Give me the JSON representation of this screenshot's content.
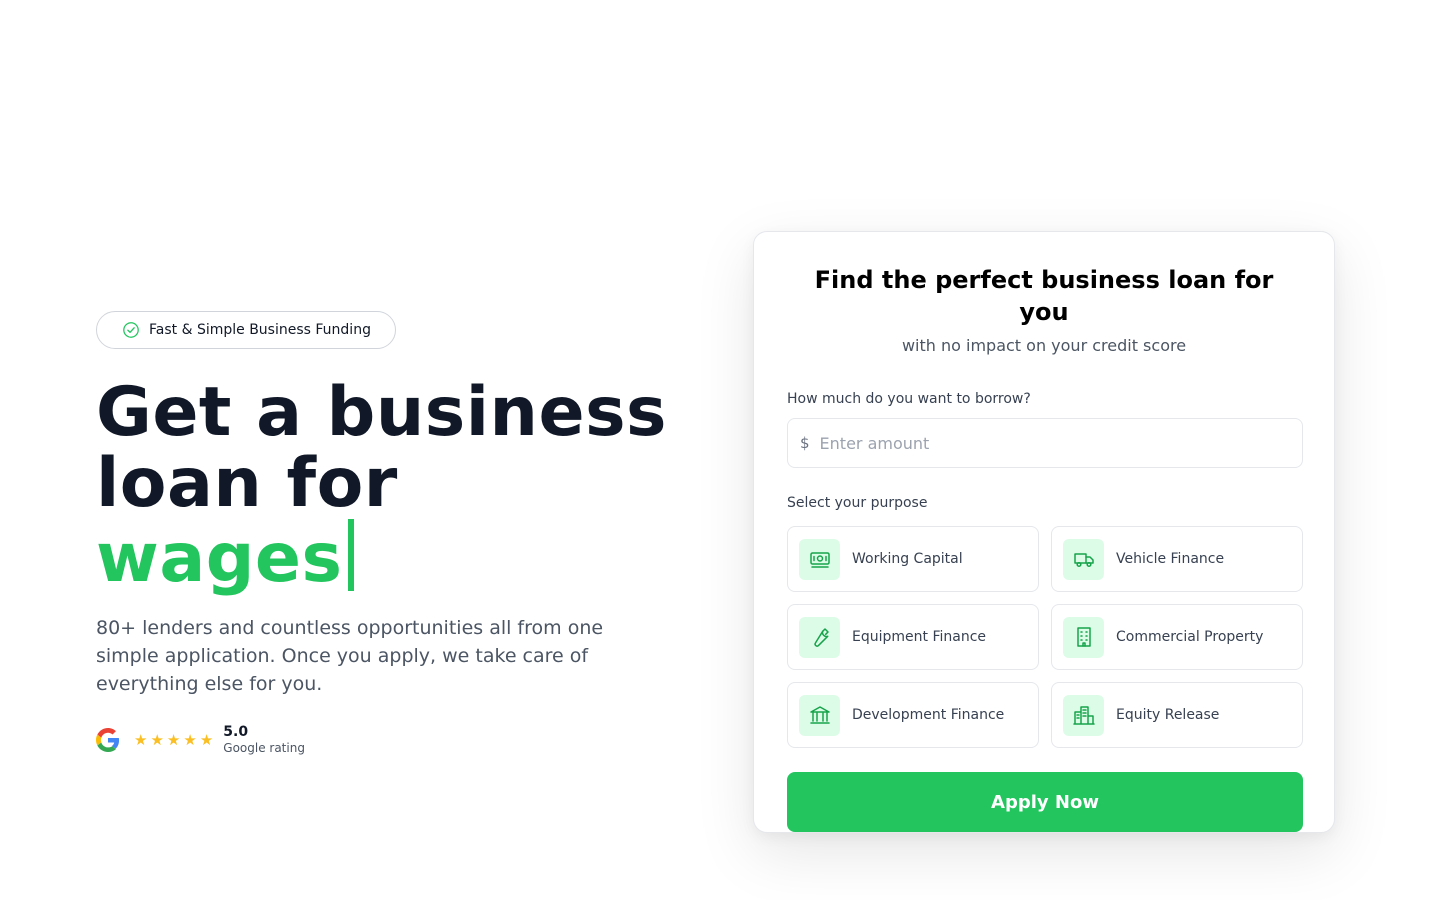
{
  "hero": {
    "badge_label": "Fast & Simple Business Funding",
    "headline_line1": "Get a business",
    "headline_line2": "loan for",
    "headline_accent": "wages",
    "description": "80+ lenders and countless opportunities all from one simple application. Once you apply, we take care of everything else for you.",
    "rating": {
      "stars": 5,
      "value": "5.0",
      "label": "Google rating"
    }
  },
  "form": {
    "title": "Find the perfect business loan for you",
    "subtitle": "with no impact on your credit score",
    "amount_label": "How much do you want to borrow?",
    "currency_symbol": "$",
    "amount_placeholder": "Enter amount",
    "amount_value": "",
    "purpose_label": "Select your purpose",
    "purposes": [
      {
        "label": "Working Capital",
        "icon": "cash-icon"
      },
      {
        "label": "Vehicle Finance",
        "icon": "truck-icon"
      },
      {
        "label": "Equipment Finance",
        "icon": "wrench-icon"
      },
      {
        "label": "Commercial Property",
        "icon": "building-icon"
      },
      {
        "label": "Development Finance",
        "icon": "bank-icon"
      },
      {
        "label": "Equity Release",
        "icon": "city-icon"
      }
    ],
    "apply_label": "Apply Now"
  },
  "colors": {
    "accent": "#22c55e",
    "accent_light": "#dcfce7",
    "heading": "#111827",
    "star": "#fbbf24"
  }
}
